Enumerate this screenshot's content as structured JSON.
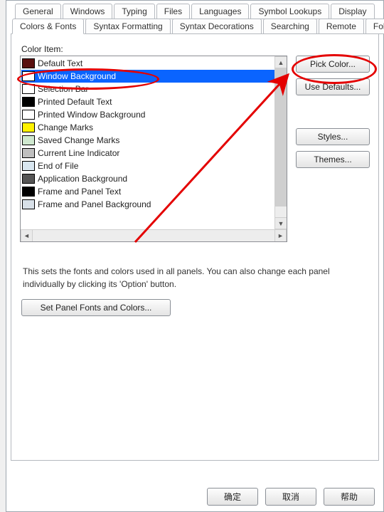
{
  "tabs_upper": [
    {
      "label": "General"
    },
    {
      "label": "Windows"
    },
    {
      "label": "Typing"
    },
    {
      "label": "Files"
    },
    {
      "label": "Languages"
    },
    {
      "label": "Symbol Lookups"
    },
    {
      "label": "Display"
    }
  ],
  "tabs_lower": [
    {
      "label": "Colors & Fonts",
      "selected": true
    },
    {
      "label": "Syntax Formatting"
    },
    {
      "label": "Syntax Decorations"
    },
    {
      "label": "Searching"
    },
    {
      "label": "Remote"
    },
    {
      "label": "Folders"
    }
  ],
  "color_item_label": "Color Item:",
  "color_items": [
    {
      "label": "Default Text",
      "swatch": "#5a1010"
    },
    {
      "label": "Window Background",
      "swatch": "#ffffff",
      "selected": true
    },
    {
      "label": "Selection Bar",
      "swatch": "#ffffff"
    },
    {
      "label": "Printed Default Text",
      "swatch": "#000000"
    },
    {
      "label": "Printed Window Background",
      "swatch": "#ffffff"
    },
    {
      "label": "Change Marks",
      "swatch": "#fff200"
    },
    {
      "label": "Saved Change Marks",
      "swatch": "#cfe8cf"
    },
    {
      "label": "Current Line Indicator",
      "swatch": "#bfbfbf"
    },
    {
      "label": "End of File",
      "swatch": "#d8e6f0"
    },
    {
      "label": "Application Background",
      "swatch": "#555555"
    },
    {
      "label": "Frame and Panel Text",
      "swatch": "#000000"
    },
    {
      "label": "Frame and Panel Background",
      "swatch": "#d8e0e8"
    }
  ],
  "buttons": {
    "pick_color": "Pick Color...",
    "use_defaults": "Use Defaults...",
    "styles": "Styles...",
    "themes": "Themes..."
  },
  "description": "This sets the fonts and colors used in all panels. You can also change each panel individually by clicking its 'Option' button.",
  "set_panel_button": "Set Panel Fonts and Colors...",
  "dialog_buttons": {
    "ok": "确定",
    "cancel": "取消",
    "help": "帮助"
  },
  "annotation": {
    "oval1": "highlight-selected-item",
    "oval2": "highlight-pick-color",
    "arrow": "arrow-to-pick-color"
  }
}
